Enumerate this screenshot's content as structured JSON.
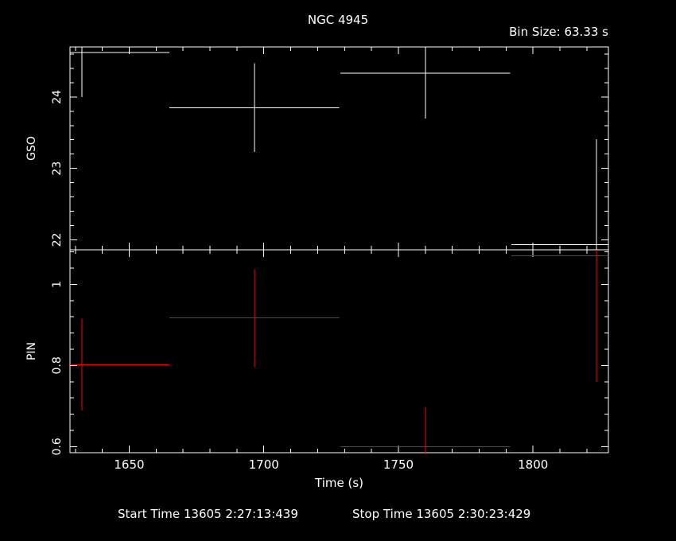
{
  "title": "NGC 4945",
  "bin_size_label": "Bin Size: 63.33 s",
  "footer": {
    "start": "Start Time 13605  2:27:13:439",
    "stop": "Stop Time 13605  2:30:23:429"
  },
  "colors": {
    "background": "#000000",
    "axes": "#ffffff",
    "gso": "#ffffff",
    "pin": "#ff0000"
  },
  "chart_data": [
    {
      "type": "scatter",
      "panel": "top",
      "ylabel": "GSO",
      "xlim": [
        1628,
        1828
      ],
      "ylim": [
        21.86,
        24.7
      ],
      "yticks": [
        22,
        23,
        24
      ],
      "color": "#ffffff",
      "points": [
        {
          "x": 1632.5,
          "xerr": 32.5,
          "y": 24.62,
          "yerr": 0.62
        },
        {
          "x": 1696.5,
          "xerr": 31.5,
          "y": 23.85,
          "yerr": 0.62
        },
        {
          "x": 1760,
          "xerr": 31.5,
          "y": 24.33,
          "yerr": 0.63
        },
        {
          "x": 1823.5,
          "xerr": 31.5,
          "y": 21.93,
          "yerr": 1.48
        }
      ]
    },
    {
      "type": "scatter",
      "panel": "bottom",
      "ylabel": "PIN",
      "xlabel": "Time (s)",
      "xlim": [
        1628,
        1828
      ],
      "ylim": [
        0.585,
        1.085
      ],
      "yticks": [
        0.6,
        0.8,
        1
      ],
      "xticks": [
        1650,
        1700,
        1750,
        1800
      ],
      "color": "#ff0000",
      "points": [
        {
          "x": 1632.5,
          "xerr": 32.5,
          "y": 0.802,
          "yerr": 0.113
        },
        {
          "x": 1696.5,
          "xerr": 31.5,
          "y": 0.917,
          "yerr": 0.12
        },
        {
          "x": 1760,
          "xerr": 31.5,
          "y": 0.6,
          "yerr": 0.098
        },
        {
          "x": 1823.5,
          "xerr": 31.5,
          "y": 1.07,
          "yerr": 0.31
        }
      ]
    }
  ]
}
